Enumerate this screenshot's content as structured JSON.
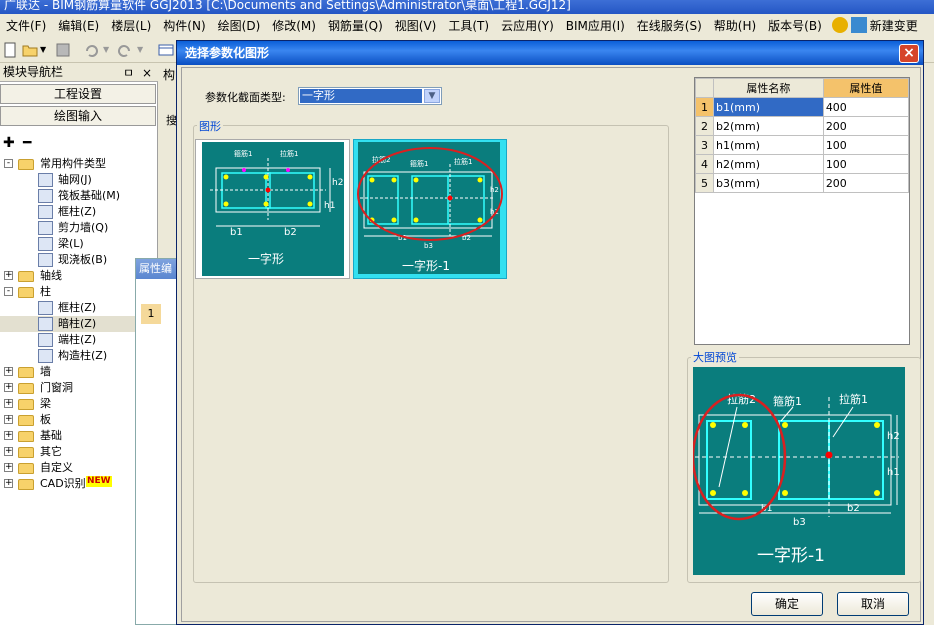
{
  "app": {
    "title": "广联达 - BIM钢筋算量软件 GGJ2013    [C:\\Documents and Settings\\Administrator\\桌面\\工程1.GGJ12]"
  },
  "menu": [
    "文件(F)",
    "编辑(E)",
    "楼层(L)",
    "构件(N)",
    "绘图(D)",
    "修改(M)",
    "钢筋量(Q)",
    "视图(V)",
    "工具(T)",
    "云应用(Y)",
    "BIM应用(I)",
    "在线服务(S)",
    "帮助(H)",
    "版本号(B)"
  ],
  "menu_extra": {
    "new_change": "新建变更"
  },
  "nav": {
    "title": "模块导航栏",
    "pin": "ㅁ",
    "close": "×",
    "btn_project": "工程设置",
    "btn_draw": "绘图输入",
    "tab_stub": "构",
    "tree": [
      {
        "label": "常用构件类型",
        "level": 0,
        "expand": "-",
        "kind": "folder"
      },
      {
        "label": "轴网(J)",
        "level": 1,
        "kind": "grid"
      },
      {
        "label": "筏板基础(M)",
        "level": 1,
        "kind": "raft"
      },
      {
        "label": "框柱(Z)",
        "level": 1,
        "kind": "col"
      },
      {
        "label": "剪力墙(Q)",
        "level": 1,
        "kind": "wall"
      },
      {
        "label": "梁(L)",
        "level": 1,
        "kind": "beam"
      },
      {
        "label": "现浇板(B)",
        "level": 1,
        "kind": "slab"
      },
      {
        "label": "轴线",
        "level": 0,
        "expand": "+",
        "kind": "folder"
      },
      {
        "label": "柱",
        "level": 0,
        "expand": "-",
        "kind": "folder"
      },
      {
        "label": "框柱(Z)",
        "level": 1,
        "kind": "col"
      },
      {
        "label": "暗柱(Z)",
        "level": 1,
        "kind": "col",
        "selected": true
      },
      {
        "label": "端柱(Z)",
        "level": 1,
        "kind": "col"
      },
      {
        "label": "构造柱(Z)",
        "level": 1,
        "kind": "gz"
      },
      {
        "label": "墙",
        "level": 0,
        "expand": "+",
        "kind": "folder"
      },
      {
        "label": "门窗洞",
        "level": 0,
        "expand": "+",
        "kind": "folder"
      },
      {
        "label": "梁",
        "level": 0,
        "expand": "+",
        "kind": "folder"
      },
      {
        "label": "板",
        "level": 0,
        "expand": "+",
        "kind": "folder"
      },
      {
        "label": "基础",
        "level": 0,
        "expand": "+",
        "kind": "folder"
      },
      {
        "label": "其它",
        "level": 0,
        "expand": "+",
        "kind": "folder"
      },
      {
        "label": "自定义",
        "level": 0,
        "expand": "+",
        "kind": "folder"
      },
      {
        "label": "CAD识别",
        "level": 0,
        "expand": "+",
        "kind": "folder",
        "badge": "NEW"
      }
    ]
  },
  "attr_panel": {
    "title": "属性编",
    "row": "1",
    "search_stub": "搜"
  },
  "dialog": {
    "title": "选择参数化图形",
    "close": "×",
    "section_label": "参数化截面类型:",
    "section_value": "一字形",
    "shapes_legend": "图形",
    "shapes": [
      {
        "name": "一字形",
        "labels": {
          "tie": "箍筋1",
          "tie2": "拉筋1",
          "b1": "b1",
          "b2": "b2",
          "h1": "h1",
          "h2": "h2"
        }
      },
      {
        "name": "一字形-1",
        "labels": {
          "tie": "拉筋2",
          "tie2": "箍筋1",
          "tie3": "拉筋1",
          "b1": "b1",
          "b2": "b2",
          "b3": "b3",
          "h1": "h1",
          "h2": "h2"
        }
      }
    ],
    "table": {
      "headers": [
        "属性名称",
        "属性值"
      ],
      "rows": [
        {
          "n": "1",
          "name": "b1(mm)",
          "value": "400"
        },
        {
          "n": "2",
          "name": "b2(mm)",
          "value": "200"
        },
        {
          "n": "3",
          "name": "h1(mm)",
          "value": "100"
        },
        {
          "n": "4",
          "name": "h2(mm)",
          "value": "100"
        },
        {
          "n": "5",
          "name": "b3(mm)",
          "value": "200"
        }
      ]
    },
    "preview_legend": "大图预览",
    "preview": {
      "title": "一字形-1",
      "tie2": "拉筋2",
      "tie": "箍筋1",
      "tie3": "拉筋1",
      "b1": "b1",
      "b2": "b2",
      "b3": "b3",
      "h1": "h1",
      "h2": "h2"
    },
    "ok": "确定",
    "cancel": "取消"
  },
  "colors": {
    "teal": "#0a7d7d",
    "accent": "#316ac5",
    "highlight": "#f4c26b",
    "annotation": "#d92020"
  }
}
